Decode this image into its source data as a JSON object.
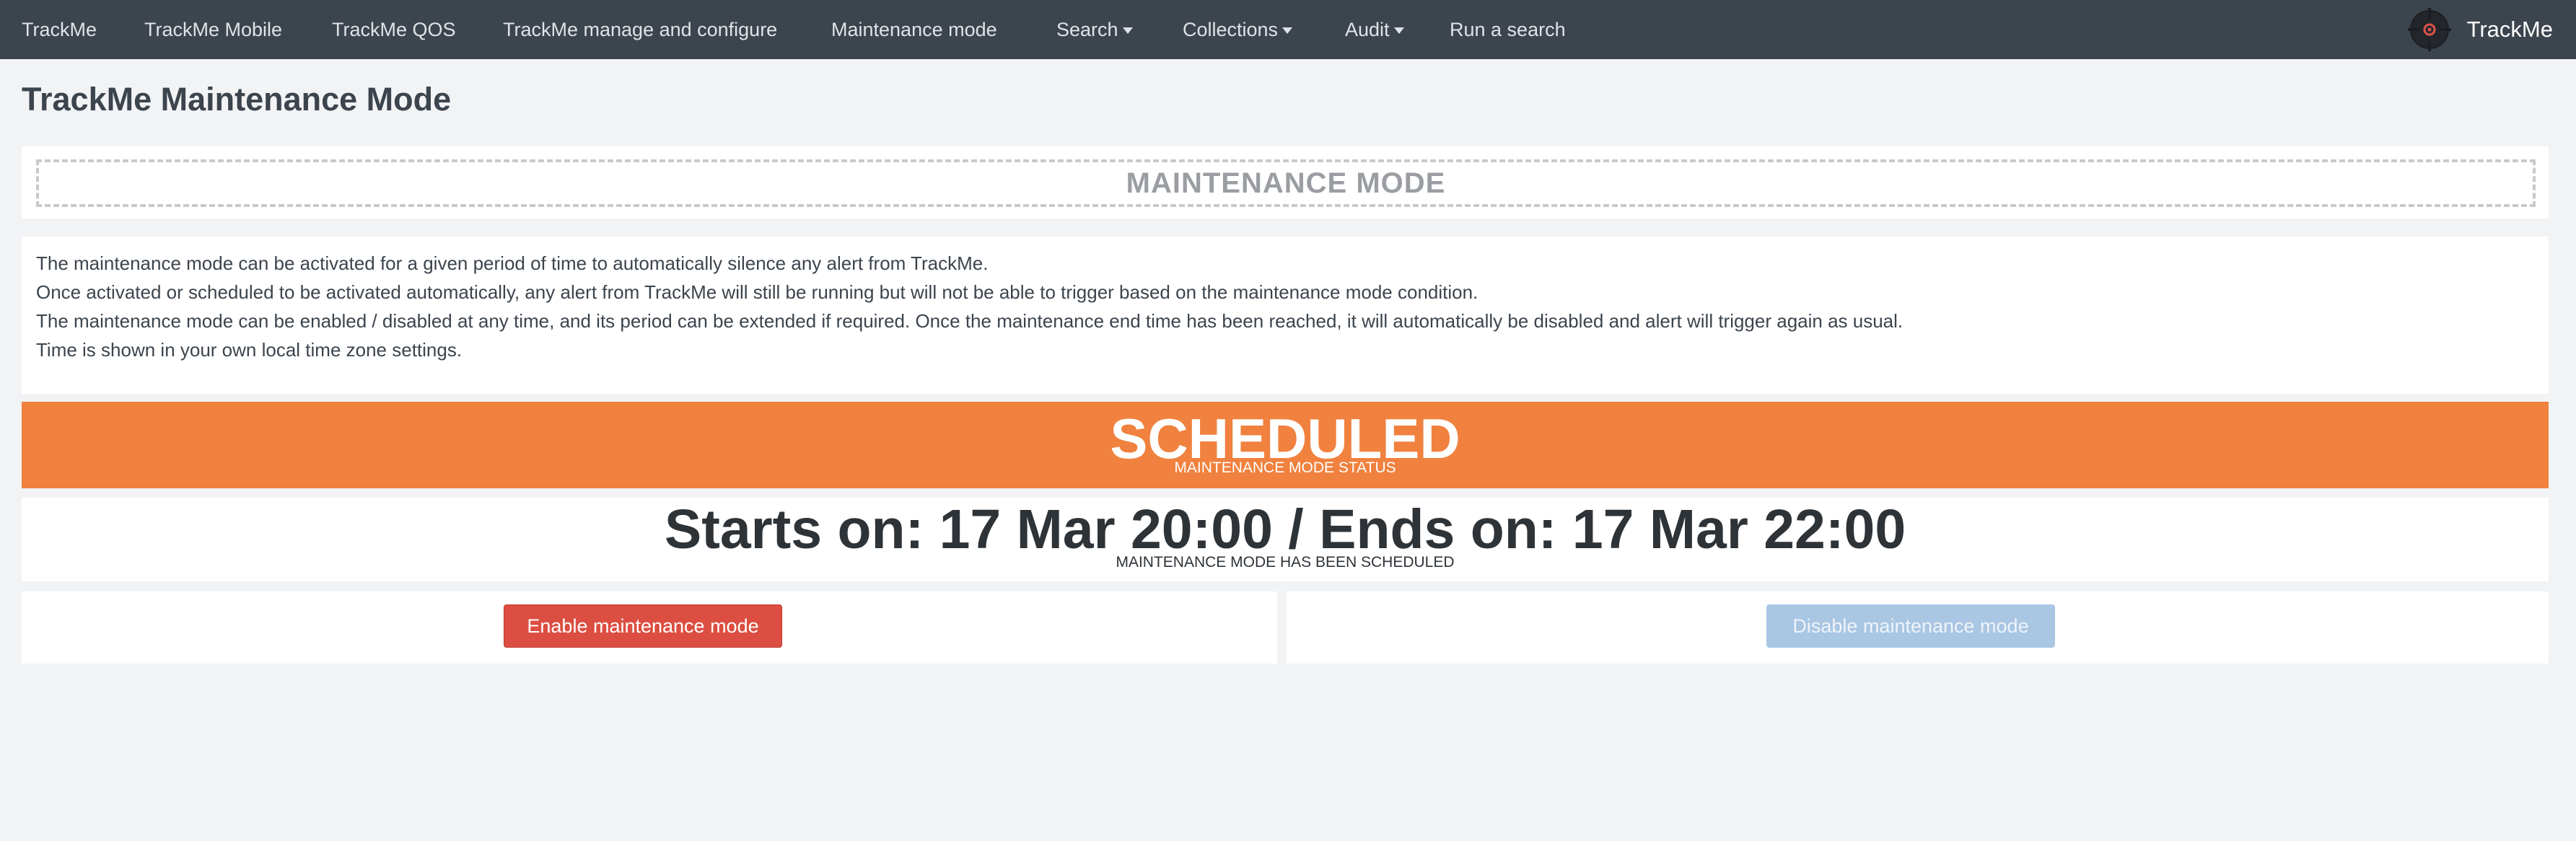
{
  "nav": {
    "items": [
      {
        "label": "TrackMe",
        "dropdown": false
      },
      {
        "label": "TrackMe Mobile",
        "dropdown": false
      },
      {
        "label": "TrackMe QOS",
        "dropdown": false
      },
      {
        "label": "TrackMe manage and configure",
        "dropdown": false
      },
      {
        "label": "Maintenance mode",
        "dropdown": false
      },
      {
        "label": "Search",
        "dropdown": true
      },
      {
        "label": "Collections",
        "dropdown": true
      },
      {
        "label": "Audit",
        "dropdown": true
      },
      {
        "label": "Run a search",
        "dropdown": false
      }
    ],
    "brand": {
      "name": "TrackMe",
      "icon": "crosshair-target-icon"
    }
  },
  "page": {
    "title": "TrackMe Maintenance Mode"
  },
  "header_panel": {
    "text": "MAINTENANCE MODE"
  },
  "description": {
    "lines": [
      "The maintenance mode can be activated for a given period of time to automatically silence any alert from TrackMe.",
      "Once activated or scheduled to be activated automatically, any alert from TrackMe will still be running but will not be able to trigger based on the maintenance mode condition.",
      "The maintenance mode can be enabled / disabled at any time, and its period can be extended if required. Once the maintenance end time has been reached, it will automatically be disabled and alert will trigger again as usual.",
      "Time is shown in your own local time zone settings."
    ]
  },
  "status": {
    "value": "SCHEDULED",
    "label": "MAINTENANCE MODE STATUS",
    "color": "#f0813e"
  },
  "schedule": {
    "value": "Starts on: 17 Mar 20:00 / Ends on: 17 Mar 22:00",
    "label": "MAINTENANCE MODE HAS BEEN SCHEDULED"
  },
  "actions": {
    "enable_label": "Enable maintenance mode",
    "enable_color": "#dc4e41",
    "disable_label": "Disable maintenance mode",
    "disable_color": "#a9c6e3",
    "disable_enabled": false
  },
  "colors": {
    "nav_bg": "#3c444d",
    "page_bg": "#f2f3f5"
  }
}
